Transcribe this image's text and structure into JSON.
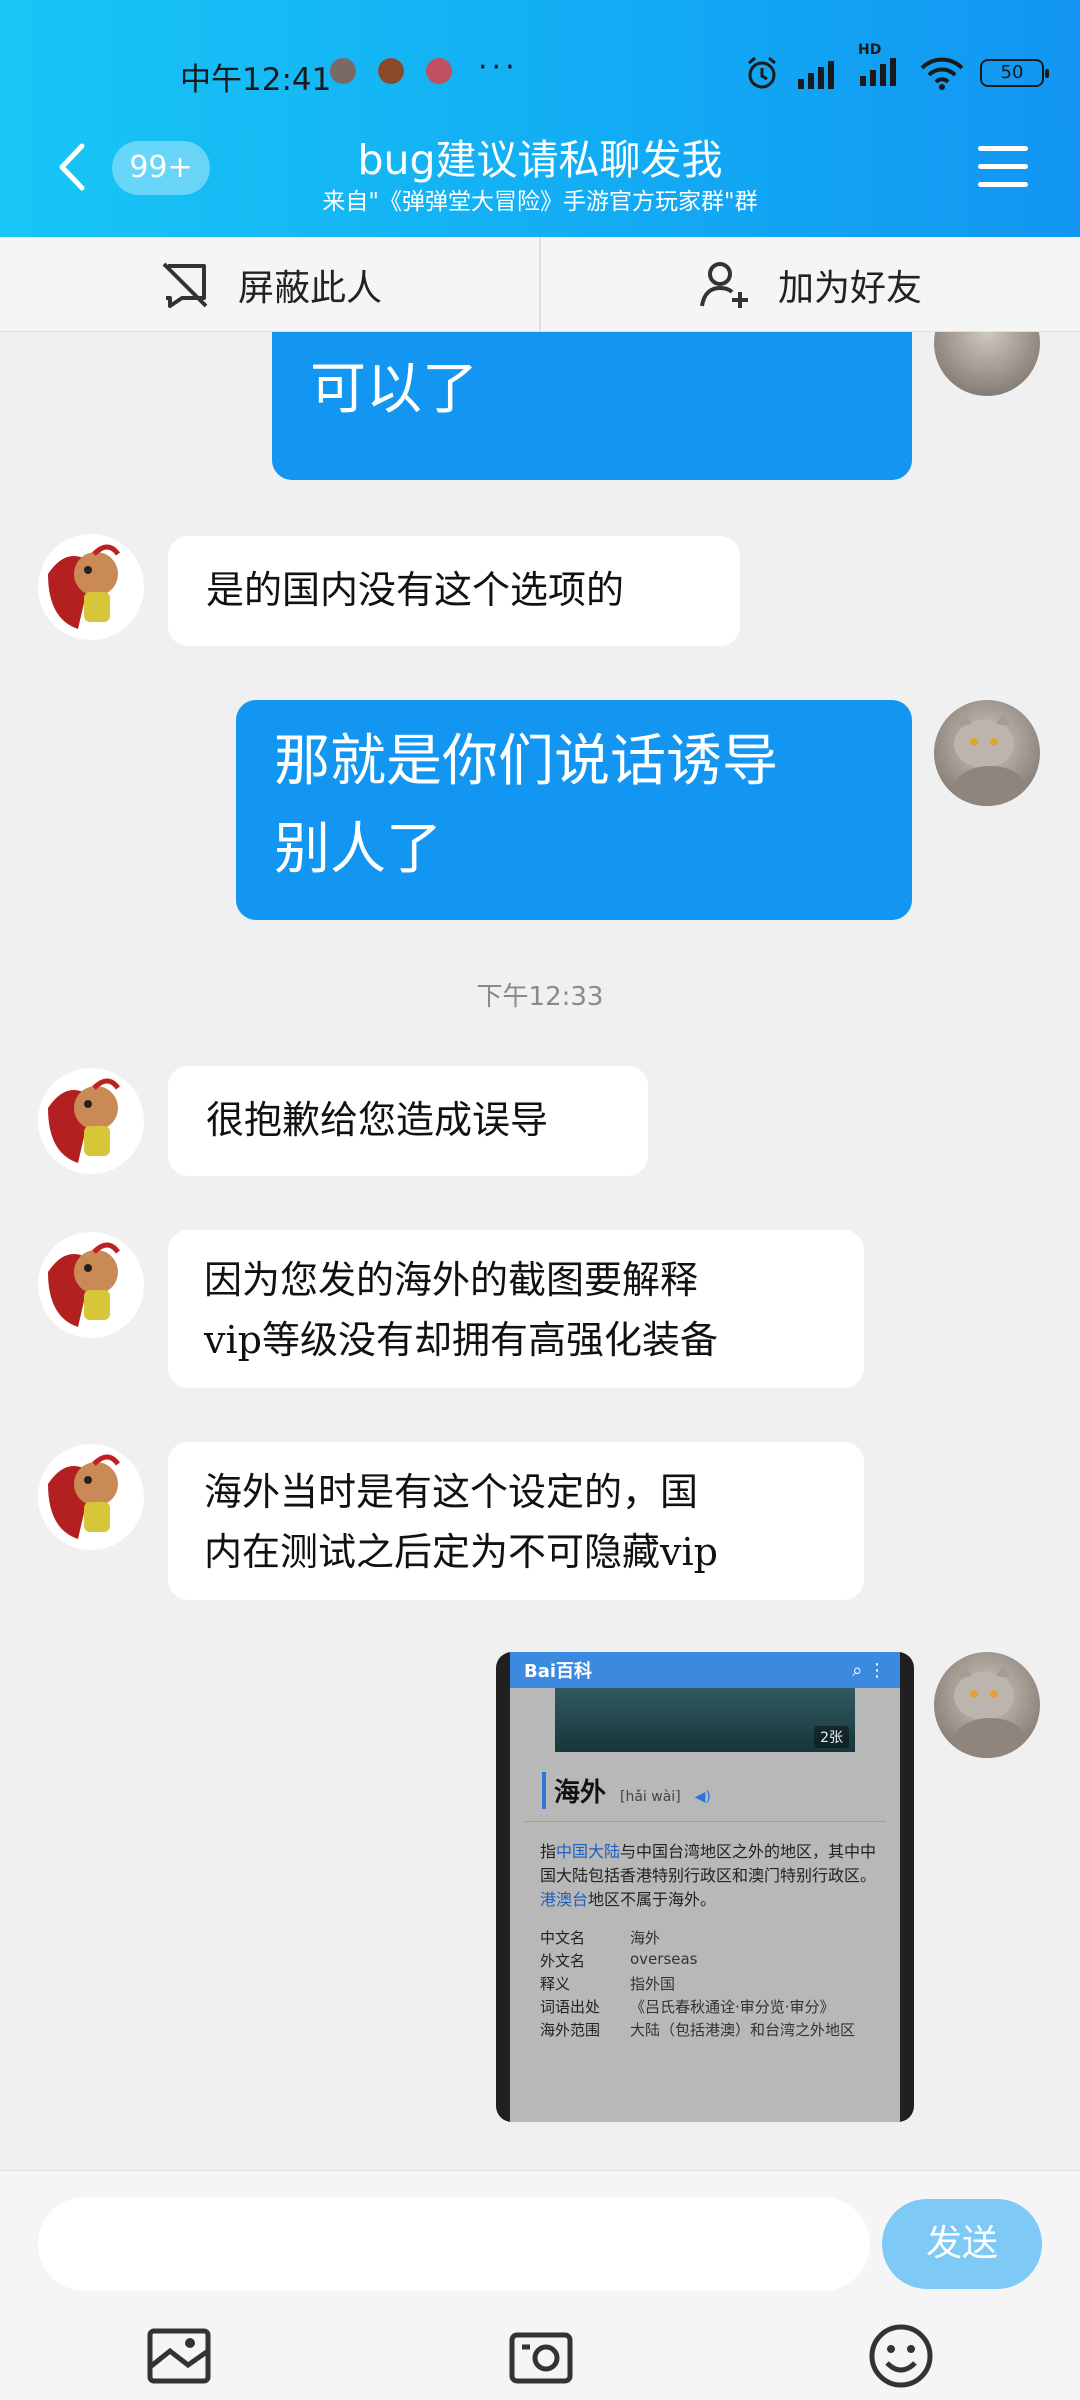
{
  "status": {
    "time": "中午12:41",
    "more": "···",
    "network": "HD",
    "battery": "50"
  },
  "header": {
    "badge": "99+",
    "title": "bug建议请私聊发我",
    "subtitle": "来自\"《弹弹堂大冒险》手游官方玩家群\"群",
    "accent": "#12aaf4"
  },
  "actions": {
    "block_label": "屏蔽此人",
    "add_friend_label": "加为好友"
  },
  "messages": [
    {
      "side": "out",
      "text_lines": [
        "可以了"
      ]
    },
    {
      "side": "in",
      "text_lines": [
        "是的国内没有这个选项的"
      ]
    },
    {
      "side": "out",
      "text_lines": [
        "那就是你们说话诱导",
        "别人了"
      ]
    },
    {
      "side": "in",
      "text_lines": [
        "很抱歉给您造成误导"
      ]
    },
    {
      "side": "in",
      "text_lines": [
        "因为您发的海外的截图要解释",
        "vip等级没有却拥有高强化装备"
      ]
    },
    {
      "side": "in",
      "text_lines": [
        "海外当时是有这个设定的，国",
        "内在测试之后定为不可隐藏vip"
      ]
    }
  ],
  "timestamp": "下午12:33",
  "image_message": {
    "app_logo": "Bai百科",
    "photo_count": "2张",
    "entry_title": "海外",
    "pinyin": "[hǎi wài]",
    "description_parts": [
      "指",
      "中国大陆",
      "与中国台湾地区之外的地区，其中中国大陆包括香港特别行政区和澳门特别行政区。",
      "港澳台",
      "地区不属于海外。"
    ],
    "rows": [
      {
        "key": "中文名",
        "value": "海外"
      },
      {
        "key": "外文名",
        "value": "overseas"
      },
      {
        "key": "释义",
        "value": "指外国"
      },
      {
        "key": "词语出处",
        "value": "《吕氏春秋通诠·审分览·审分》"
      },
      {
        "key": "海外范围",
        "value": "大陆（包括港澳）和台湾之外地区"
      }
    ]
  },
  "composer": {
    "input_value": "",
    "send_label": "发送"
  }
}
